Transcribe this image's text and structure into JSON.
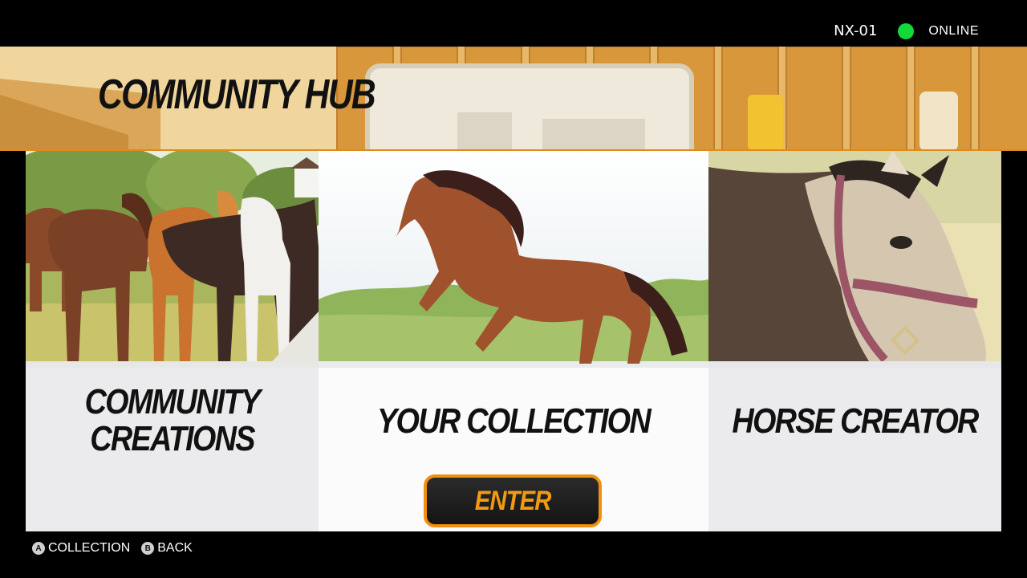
{
  "status_bar": {
    "user": "NX-01",
    "online_label": "ONLINE",
    "online_color": "#12d83a"
  },
  "header": {
    "title": "COMMUNITY HUB"
  },
  "cards": [
    {
      "label": "COMMUNITY CREATIONS",
      "image": "horse-herd-illustration"
    },
    {
      "label": "YOUR COLLECTION",
      "image": "galloping-bay-horse-illustration",
      "button_label": "ENTER"
    },
    {
      "label": "HORSE CREATOR",
      "image": "buckskin-horse-portrait-illustration"
    }
  ],
  "hints": [
    {
      "glyph": "A",
      "label": "COLLECTION"
    },
    {
      "glyph": "B",
      "label": "BACK"
    }
  ],
  "colors": {
    "accent": "#f0900f",
    "header_border": "#e08a1e"
  }
}
